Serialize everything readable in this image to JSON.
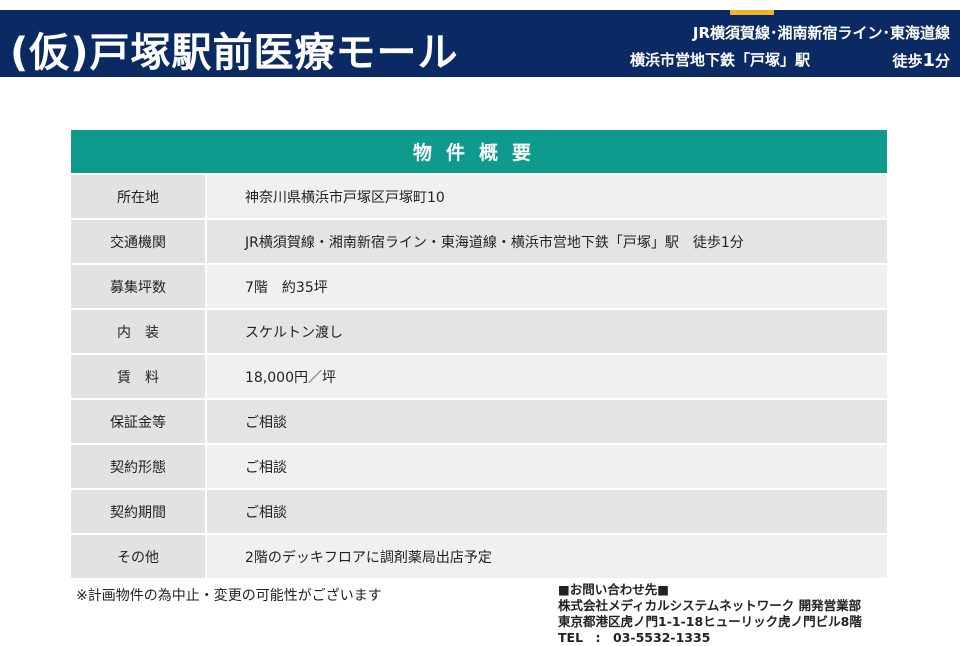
{
  "header": {
    "title": "(仮)戸塚駅前医療モール",
    "access_line1": "JR横須賀線･湘南新宿ライン･東海道線",
    "access_line2_station": "横浜市営地下鉄「戸塚」駅",
    "access_walk_label": "徒歩",
    "access_walk_minutes": "1",
    "access_walk_unit": "分"
  },
  "table": {
    "title": "物件概要",
    "rows": [
      {
        "label": "所在地",
        "value": "神奈川県横浜市戸塚区戸塚町10"
      },
      {
        "label": "交通機関",
        "value": "JR横須賀線・湘南新宿ライン・東海道線・横浜市営地下鉄「戸塚」駅　徒歩1分"
      },
      {
        "label": "募集坪数",
        "value": "7階　約35坪"
      },
      {
        "label": "内　装",
        "value": "スケルトン渡し"
      },
      {
        "label": "賃　料",
        "value": "18,000円／坪"
      },
      {
        "label": "保証金等",
        "value": "ご相談"
      },
      {
        "label": "契約形態",
        "value": "ご相談"
      },
      {
        "label": "契約期間",
        "value": "ご相談"
      },
      {
        "label": "その他",
        "value": "2階のデッキフロアに調剤薬局出店予定"
      }
    ]
  },
  "footer": {
    "note": "※計画物件の為中止・変更の可能性がございます",
    "contact_heading": "■お問い合わせ先■",
    "contact_company": "株式会社メディカルシステムネットワーク 開発営業部",
    "contact_address": "東京都港区虎ノ門1-1-18ヒューリック虎ノ門ビル8階",
    "contact_tel": "TEL　:　03-5532-1335"
  }
}
